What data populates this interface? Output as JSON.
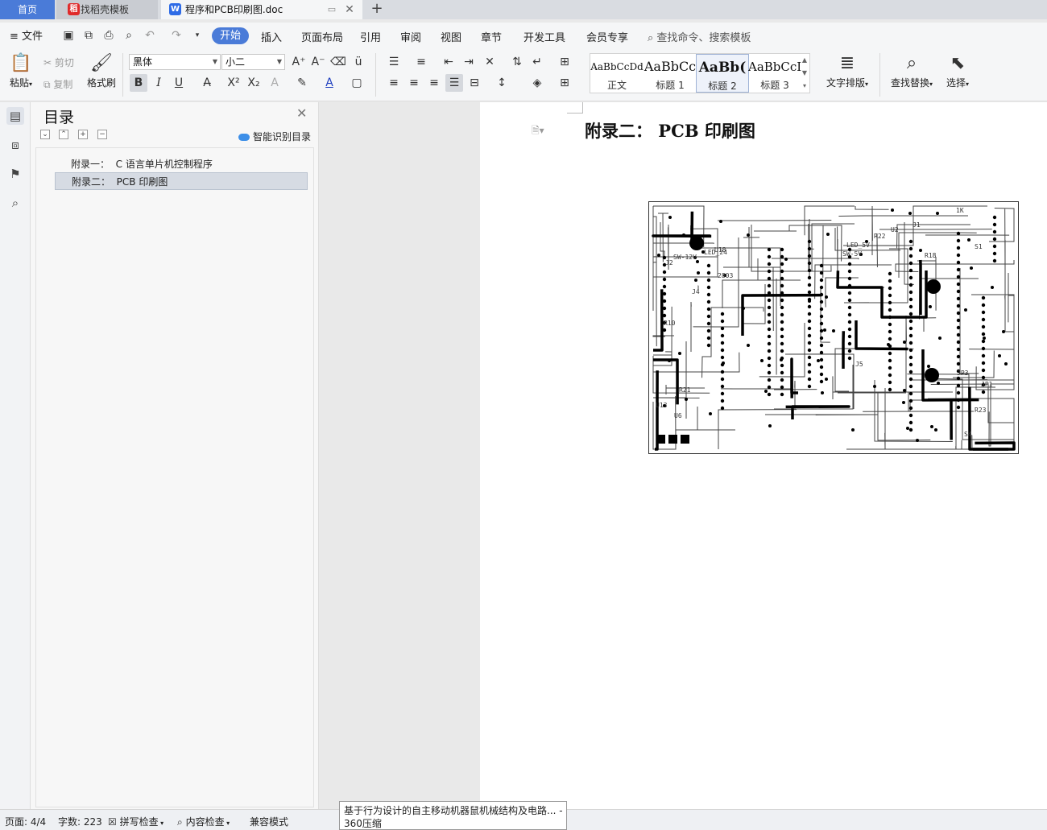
{
  "tabs": {
    "home": "首页",
    "template": "找稻壳模板",
    "document": "程序和PCB印刷图.doc"
  },
  "menu": {
    "file": "文件",
    "items": [
      "开始",
      "插入",
      "页面布局",
      "引用",
      "审阅",
      "视图",
      "章节",
      "开发工具",
      "会员专享"
    ],
    "search": "查找命令、搜索模板"
  },
  "ribbon": {
    "paste": "粘贴",
    "cut": "剪切",
    "copy": "复制",
    "format_painter": "格式刷",
    "font_name": "黑体",
    "font_size": "小二",
    "styles": [
      {
        "sample": "AaBbCcDd",
        "label": "正文"
      },
      {
        "sample": "AaBbCc",
        "label": "标题 1"
      },
      {
        "sample": "AaBb(",
        "label": "标题 2"
      },
      {
        "sample": "AaBbCcI",
        "label": "标题 3"
      }
    ],
    "text_layout": "文字排版",
    "find_replace": "查找替换",
    "select": "选择"
  },
  "toc": {
    "title": "目录",
    "smart": "智能识别目录",
    "items": [
      {
        "num": "附录一：",
        "text": "C 语言单片机控制程序"
      },
      {
        "num": "附录二：",
        "text": "PCB 印刷图"
      }
    ]
  },
  "document": {
    "heading": "附录二：  PCB 印刷图"
  },
  "status": {
    "page": "页面: 4/4",
    "words": "字数: 223",
    "spell": "拼写检查",
    "content": "内容检查",
    "compat": "兼容模式"
  },
  "tooltip": {
    "line1": "基于行为设计的自主移动机器鼠机械结构及电路... -",
    "line2": "360压缩"
  },
  "pcb_labels": [
    "J5",
    "J4",
    "U2",
    "U6",
    "S1",
    "SW-5V",
    "SW-12V",
    "LED_24",
    "2803",
    "S4",
    "JP1",
    "JP3",
    "R10",
    "R18",
    "R21",
    "R22",
    "R23",
    "U13",
    "U18",
    "J1",
    "J2",
    "1K",
    "LED_5V"
  ]
}
